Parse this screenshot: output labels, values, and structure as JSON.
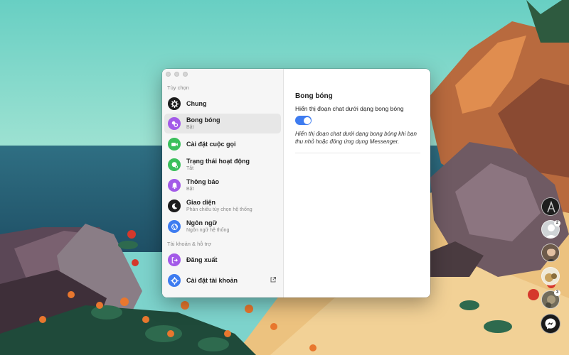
{
  "sidebar": {
    "section_options": "Tùy chọn",
    "section_account": "Tài khoản & hỗ trợ",
    "items": [
      {
        "title": "Chung",
        "sub": "",
        "icon": "gear-icon",
        "color": "#1c1c1c"
      },
      {
        "title": "Bong bóng",
        "sub": "Bật",
        "icon": "bubbles-icon",
        "color": "#a35ae8"
      },
      {
        "title": "Cài đặt cuộc gọi",
        "sub": "",
        "icon": "video-camera-icon",
        "color": "#3bbf5c"
      },
      {
        "title": "Trạng thái hoạt động",
        "sub": "Tắt",
        "icon": "activity-status-icon",
        "color": "#3bbf5c"
      },
      {
        "title": "Thông báo",
        "sub": "Bật",
        "icon": "bell-icon",
        "color": "#a35ae8"
      },
      {
        "title": "Giao diện",
        "sub": "Phản chiếu tùy chọn hệ thống",
        "icon": "moon-icon",
        "color": "#1c1c1c"
      },
      {
        "title": "Ngôn ngữ",
        "sub": "Ngôn ngữ hệ thống",
        "icon": "globe-icon",
        "color": "#3e7cf0"
      },
      {
        "title": "Đăng xuất",
        "sub": "",
        "icon": "logout-icon",
        "color": "#a35ae8"
      },
      {
        "title": "Cài đặt tài khoản",
        "sub": "",
        "icon": "gear-icon",
        "color": "#3e7cf0"
      }
    ]
  },
  "content": {
    "title": "Bong bóng",
    "toggle_label": "Hiển thị đoạn chat dưới dạng bong bóng",
    "toggle_on": true,
    "description": "Hiển thị đoạn chat dưới dạng bong bóng khi bạn thu nhỏ hoặc đóng ứng dụng Messenger."
  },
  "chatheads": {
    "badges": [
      "2",
      "3"
    ]
  },
  "colors": {
    "accent": "#3e7cf0"
  }
}
